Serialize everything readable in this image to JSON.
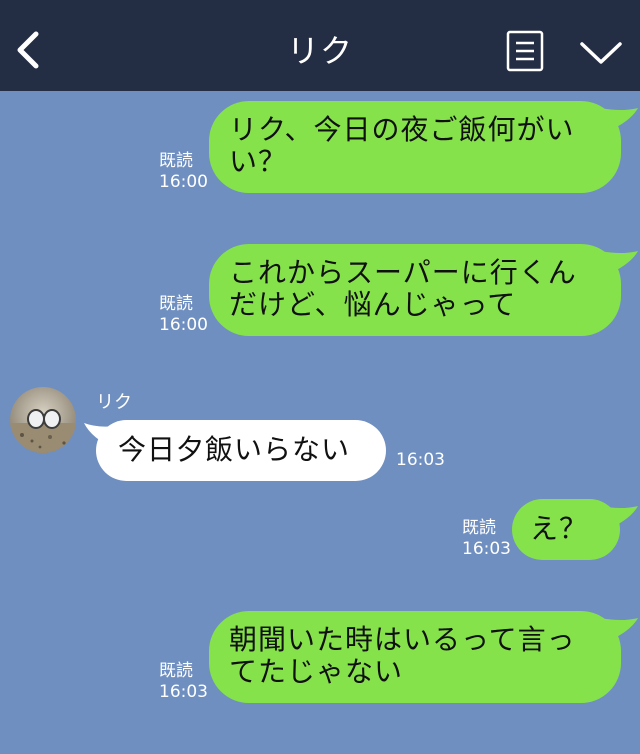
{
  "header": {
    "title": "リク",
    "back_icon": "chevron-left-icon",
    "menu_icon": "menu-list-icon",
    "expand_icon": "chevron-down-icon"
  },
  "colors": {
    "header_bg": "#232d44",
    "chat_bg": "#6f8fc0",
    "outgoing_bubble": "#86e24a",
    "incoming_bubble": "#ffffff"
  },
  "messages": [
    {
      "direction": "out",
      "lines": [
        "リク、今日の夜ご飯何がい",
        "い？"
      ],
      "read": "既読",
      "time": "16:00"
    },
    {
      "direction": "out",
      "lines": [
        "これからスーパーに行くん",
        "だけど、悩んじゃって"
      ],
      "read": "既読",
      "time": "16:00"
    },
    {
      "direction": "in",
      "sender": "リク",
      "lines": [
        "今日夕飯いらない"
      ],
      "time": "16:03"
    },
    {
      "direction": "out",
      "lines": [
        "え？"
      ],
      "read": "既読",
      "time": "16:03"
    },
    {
      "direction": "out",
      "lines": [
        "朝聞いた時はいるって言っ",
        "てたじゃない"
      ],
      "read": "既読",
      "time": "16:03"
    }
  ]
}
